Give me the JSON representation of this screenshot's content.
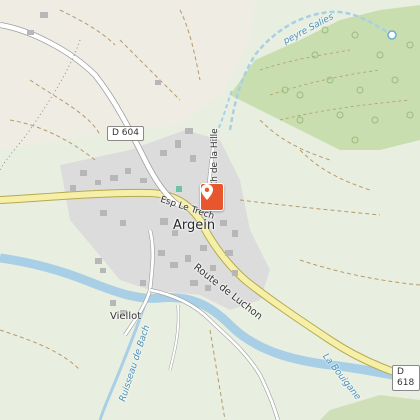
{
  "map": {
    "labels": {
      "town": "Argein",
      "hamlet": "Viellot",
      "route_main": "Route de Luchon",
      "street_esp": "Esp Le Tréch",
      "street_hille": "Ch de la Hille",
      "river_salies": "peyre Salies",
      "stream_bach": "Ruisseau de Bach",
      "river_bouigane": "La Bouigane"
    },
    "roads": {
      "d604": "D 604",
      "d618": "D 618"
    },
    "marker": {
      "icon": "location-pin-icon",
      "color": "#e8562d"
    },
    "colors": {
      "meadow": "#e9efe0",
      "forest": "#c9deae",
      "water": "#a8cfe6",
      "main_road": "#f5efa8",
      "village_area": "#dcdcdc"
    }
  }
}
